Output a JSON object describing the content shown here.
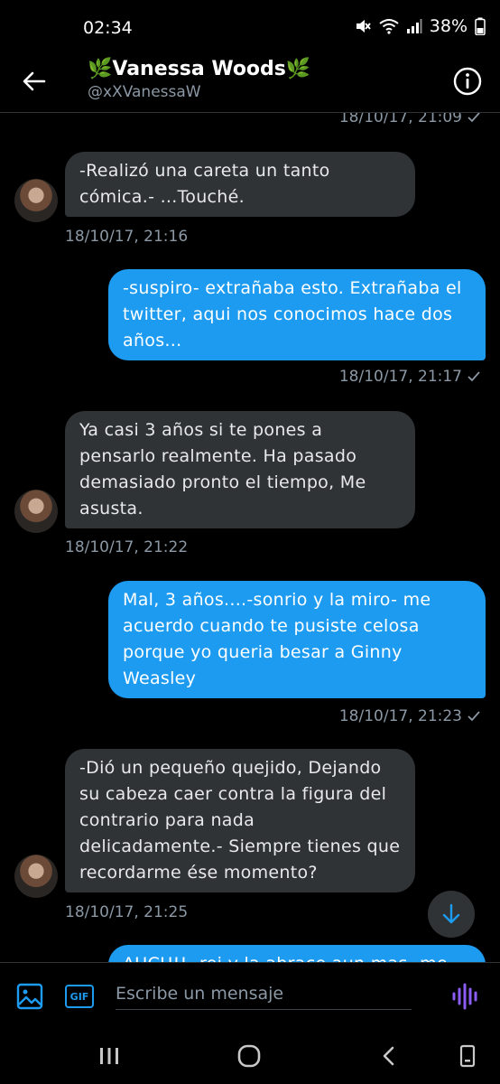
{
  "status_bar": {
    "time": "02:34",
    "battery": "38%"
  },
  "header": {
    "name": "🌿Vanessa Woods🌿",
    "handle": "@xXVanessaW"
  },
  "messages": [
    {
      "direction": "out",
      "text": "",
      "timestamp": "18/10/17, 21:09",
      "read": true
    },
    {
      "direction": "in",
      "text": "-Realizó una careta un tanto cómica.- ...Touché.",
      "timestamp": "18/10/17, 21:16"
    },
    {
      "direction": "out",
      "text": "-suspiro- extrañaba esto. Extrañaba el twitter, aqui nos conocimos hace dos años...",
      "timestamp": "18/10/17, 21:17",
      "read": true
    },
    {
      "direction": "in",
      "text": "Ya casi 3 años si te pones a pensarlo realmente. Ha pasado demasiado pronto el tiempo, Me asusta.",
      "timestamp": "18/10/17, 21:22"
    },
    {
      "direction": "out",
      "text": "Mal, 3 años....-sonrio y la miro- me acuerdo cuando te pusiste celosa porque yo queria besar a Ginny Weasley",
      "timestamp": "18/10/17, 21:23",
      "read": true
    },
    {
      "direction": "in",
      "text": "-Dió un pequeño quejido, Dejando su cabeza caer contra la figura del contrario para nada delicadamente.- Siempre tienes que recordarme ése momento?",
      "timestamp": "18/10/17, 21:25"
    },
    {
      "direction": "out",
      "text": "AUCH!! -rei y la abrace aun mas- me de",
      "timestamp": ""
    }
  ],
  "compose": {
    "placeholder": "Escribe un mensaje",
    "gif_label": "GIF"
  },
  "icons": {
    "back": "arrow-left-icon",
    "info": "info-icon",
    "media": "image-icon",
    "gif": "gif-icon",
    "voice": "voice-waveform-icon",
    "scroll_down": "arrow-down-icon"
  },
  "colors": {
    "accent": "#1d9bf0",
    "incoming_bubble": "#2f3336",
    "background": "#000000",
    "muted_text": "#8b98a5"
  }
}
